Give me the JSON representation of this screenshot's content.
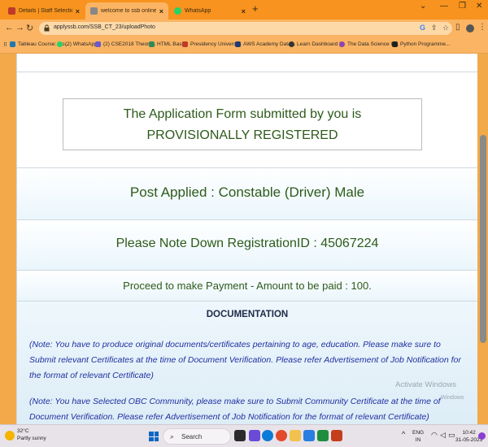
{
  "browser": {
    "tabs": [
      {
        "title": "Details | Staff Selection Commiss",
        "fav_color": "#c0392b"
      },
      {
        "title": "welcome to ssb online applicatio",
        "fav_color": "#555555"
      },
      {
        "title": "WhatsApp",
        "fav_color": "#25d366"
      }
    ],
    "url": "applyssb.com/SSB_CT_23/uploadPhoto",
    "bookmarks": [
      {
        "label": "Tableau Course: Do...",
        "color": "#1f77b4"
      },
      {
        "label": "(2) WhatsApp",
        "color": "#25d366"
      },
      {
        "label": "(2) CSE2018 Theory...",
        "color": "#6a5acd"
      },
      {
        "label": "HTML Basic",
        "color": "#2e8b57"
      },
      {
        "label": "Presidency Universi...",
        "color": "#c0392b"
      },
      {
        "label": "AWS Academy Data...",
        "color": "#1f3b73"
      },
      {
        "label": "Learn Dashboard |...",
        "color": "#333333"
      },
      {
        "label": "The Data Science C...",
        "color": "#8e44ad"
      },
      {
        "label": "Python Programme...",
        "color": "#222222"
      }
    ]
  },
  "page": {
    "banner_line1": "The Application Form submitted by you is",
    "banner_line2": "PROVISIONALLY REGISTERED",
    "post_applied": "Post Applied : Constable (Driver) Male",
    "registration": "Please Note Down RegistrationID : 45067224",
    "payment": "Proceed to make Payment - Amount to be paid : 100.",
    "documentation_title": "DOCUMENTATION",
    "note1": "(Note: You have to produce original documents/certificates pertaining to age, education. Please make sure to Submit relevant Certificates at the time of Document Verification. Please refer Advertisement of Job Notification for the format of relevant Certificate)",
    "note2": "(Note: You have Selected OBC Community, please make sure to Submit Community Certificate at the time of Document Verification. Please refer Advertisement of Job Notification for the format of relevant Certificate)",
    "watermark1": "Activate Windows",
    "watermark2": "Windows"
  },
  "taskbar": {
    "temperature": "32°C",
    "weather": "Partly sunny",
    "search_label": "Search",
    "lang1": "ENG",
    "lang2": "IN",
    "time": "10:42",
    "date": "31-05-2023"
  }
}
